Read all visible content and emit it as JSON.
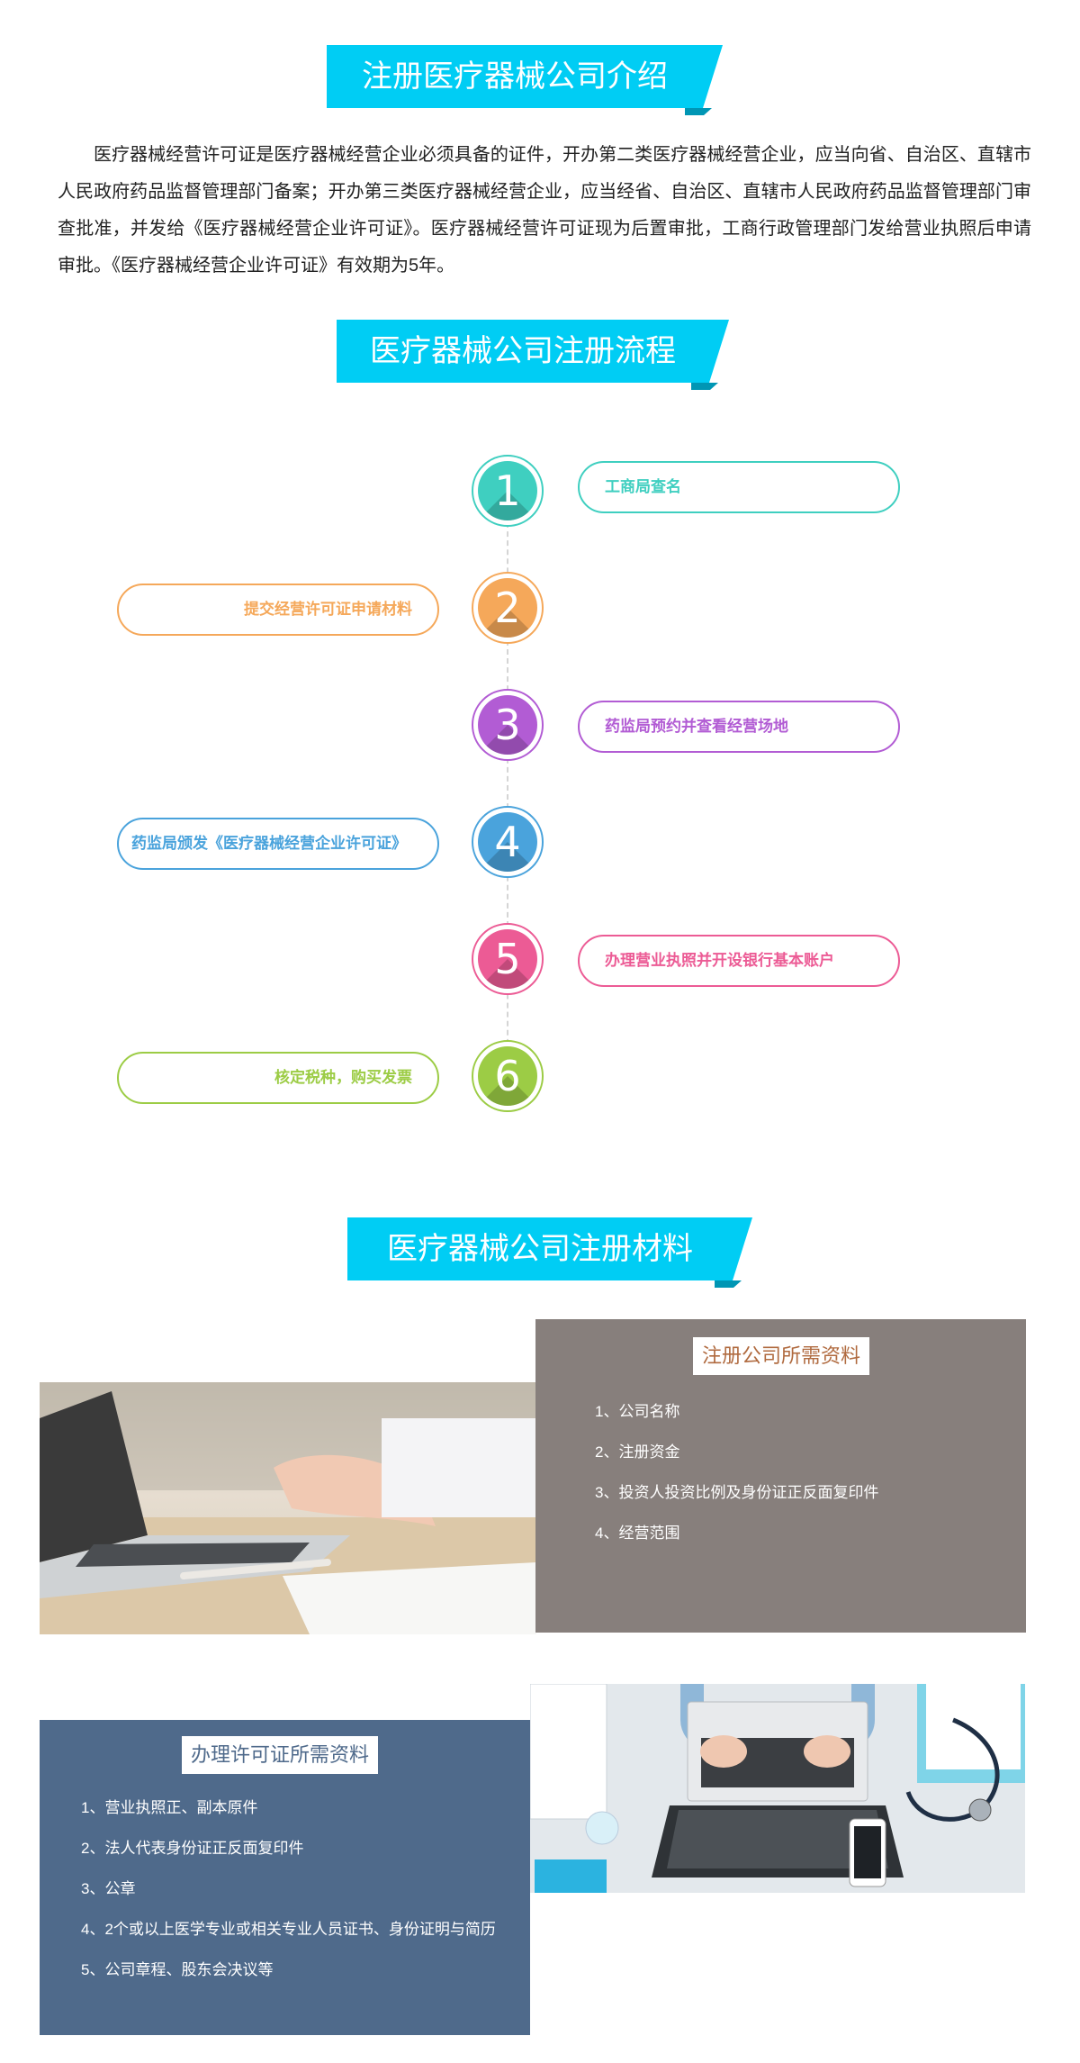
{
  "sections": {
    "intro_title": "注册医疗器械公司介绍",
    "process_title": "医疗器械公司注册流程",
    "materials_title": "医疗器械公司注册材料"
  },
  "intro_text": "医疗器械经营许可证是医疗器械经营企业必须具备的证件，开办第二类医疗器械经营企业，应当向省、自治区、直辖市人民政府药品监督管理部门备案；开办第三类医疗器械经营企业，应当经省、自治区、直辖市人民政府药品监督管理部门审查批准，并发给《医疗器械经营企业许可证》。医疗器械经营许可证现为后置审批，工商行政管理部门发给营业执照后申请审批。《医疗器械经营企业许可证》有效期为5年。",
  "steps": [
    {
      "num": "1",
      "label": "工商局查名",
      "color": "#3fcfc0"
    },
    {
      "num": "2",
      "label": "提交经营许可证申请材料",
      "color": "#f5a85a"
    },
    {
      "num": "3",
      "label": "药监局预约并查看经营场地",
      "color": "#b25cd4"
    },
    {
      "num": "4",
      "label": "药监局颁发《医疗器械经营企业许可证》",
      "color": "#4aa3dc"
    },
    {
      "num": "5",
      "label": "办理营业执照并开设银行基本账户",
      "color": "#ec5b95"
    },
    {
      "num": "6",
      "label": "核定税种，购买发票",
      "color": "#9ccc45"
    }
  ],
  "company_materials": {
    "title": "注册公司所需资料",
    "items": [
      "1、公司名称",
      "2、注册资金",
      "3、投资人投资比例及身份证正反面复印件",
      "4、经营范围"
    ]
  },
  "license_materials": {
    "title": "办理许可证所需资料",
    "items": [
      "1、营业执照正、副本原件",
      "2、法人代表身份证正反面复印件",
      "3、公章",
      "4、2个或以上医学专业或相关专业人员证书、身份证明与简历",
      "5、公司章程、股东会决议等"
    ]
  }
}
